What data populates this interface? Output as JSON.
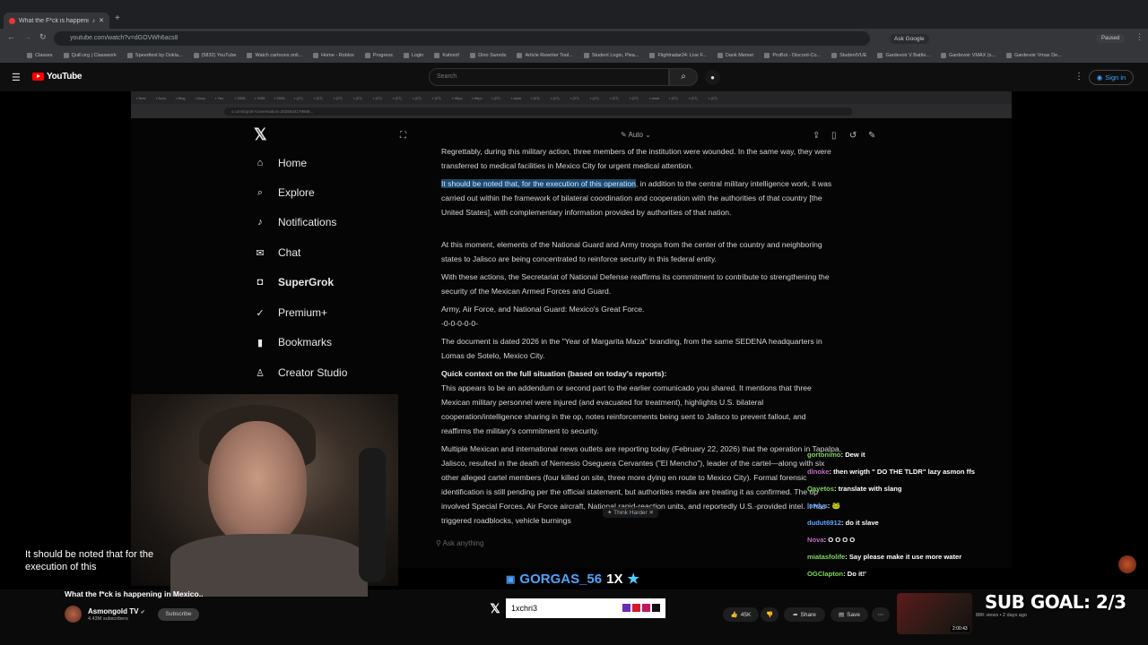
{
  "browser": {
    "tab_title": "What the F*ck is happening...",
    "url": "youtube.com/watch?v=dGOVWh6acs8",
    "ask_google": "Ask Google",
    "paused": "Paused",
    "bookmarks": [
      "Classes",
      "Quill.org | Classwork",
      "Speedtest by Ookla...",
      "(5832) YouTube",
      "Watch cartoons onli...",
      "Home - Roblox",
      "Progress",
      "Login",
      "Kahoot!",
      "Dino Swords",
      "Article Rewriter Tool...",
      "Student Login, Plea...",
      "Flightradar24: Live F...",
      "Dank Memer",
      "ProBot - Discord-Co...",
      "StudentVUE",
      "Gardevoir V Battle...",
      "Gardevoir VMAX (s...",
      "Gardevoir Vmax De..."
    ]
  },
  "youtube": {
    "logo_text": "YouTube",
    "search_placeholder": "Search",
    "sign_in": "Sign in",
    "video_title": "What the f*ck is happening in Mexico..",
    "channel_name": "Asmongold TV",
    "channel_subs": "4.43M subscribers",
    "subscribe_label": "Subscribe",
    "likes": "45K",
    "share": "Share",
    "save": "Save",
    "next_views": "88K views • 2 days ago",
    "next_duration": "2:00:43"
  },
  "xpage": {
    "nav": [
      {
        "label": "Home",
        "icon": "home-icon",
        "glyph": "⌂"
      },
      {
        "label": "Explore",
        "icon": "search-icon",
        "glyph": "⌕"
      },
      {
        "label": "Notifications",
        "icon": "bell-icon",
        "glyph": "♪"
      },
      {
        "label": "Chat",
        "icon": "mail-icon",
        "glyph": "✉"
      },
      {
        "label": "SuperGrok",
        "icon": "grok-icon",
        "glyph": "◘"
      },
      {
        "label": "Premium+",
        "icon": "premium-icon",
        "glyph": "✓"
      },
      {
        "label": "Bookmarks",
        "icon": "bookmark-icon",
        "glyph": "▮"
      },
      {
        "label": "Creator Studio",
        "icon": "creator-icon",
        "glyph": "♙"
      }
    ],
    "mode": "Auto",
    "paragraphs": {
      "p1": "Regrettably, during this military action, three members of the institution were wounded. In the same way, they were transferred to medical facilities in Mexico City for urgent medical attention.",
      "p2_highlight": "It should be noted that, for the execution of this operation",
      "p2_rest": ", in addition to the central military intelligence work, it was carried out within the framework of bilateral coordination and cooperation with the authorities of that country [the United States], with complementary information provided by authorities of that nation.",
      "p3": "At this moment, elements of the National Guard and Army troops from the center of the country and neighboring states to Jalisco are being concentrated to reinforce security in this federal entity.",
      "p4": "With these actions, the Secretariat of National Defense reaffirms its commitment to contribute to strengthening the security of the Mexican Armed Forces and Guard.",
      "p5a": "Army, Air Force, and National Guard: Mexico's Great Force.",
      "p5b": "-0-0-0-0-0-",
      "p6": "The document is dated 2026 in the \"Year of Margarita Maza\" branding, from the same SEDENA headquarters in Lomas de Sotelo, Mexico City.",
      "p7_heading": "Quick context on the full situation (based on today's reports):",
      "p7": "This appears to be an addendum or second part to the earlier comunicado you shared. It mentions that three Mexican military personnel were injured (and evacuated for treatment), highlights U.S. bilateral cooperation/intelligence sharing in the op, notes reinforcements being sent to Jalisco to prevent fallout, and reaffirms the military's commitment to security.",
      "p8": "Multiple Mexican and international news outlets are reporting today (February 22, 2026) that the operation in Tapalpa, Jalisco, resulted in the death of Nemesio Oseguera Cervantes (\"El Mencho\"), leader of the cartel—along with six other alleged cartel members (four killed on site, three more dying en route to Mexico City). Formal forensic identification is still pending per the official statement, but authorities media are treating it as confirmed. The op involved Special Forces, Air Force aircraft, National rapid-reaction units, and reportedly U.S.-provided intel. It has triggered roadblocks, vehicle burnings"
    },
    "think_harder": "Think Harder",
    "ask_placeholder": "Ask anything"
  },
  "chat": [
    {
      "user": "gortonimo",
      "msg": "Dew it"
    },
    {
      "user": "dlnoke",
      "msg": "then wrigth \" DO THE TLDR\" lazy asmon ffs"
    },
    {
      "user": "Qayetos",
      "msg": "translate with slang"
    },
    {
      "user": "lawlys",
      "msg": ""
    },
    {
      "user": "dudut6912",
      "msg": "do it slave"
    },
    {
      "user": "Nova",
      "msg": "O O O O"
    },
    {
      "user": "miatasfolife",
      "msg": "Say please make it use more water"
    },
    {
      "user": "OGClapton",
      "msg": "Do it!'"
    }
  ],
  "overlay": {
    "caption": "It should be noted that for the execution of this",
    "gorgas_name": "GORGAS_56",
    "gorgas_mult": "1X",
    "x_handle": "1xchri3",
    "sub_goal": "SUB GOAL: 2/3",
    "colors": {
      "accent": "#4ea3ff",
      "sq1": "#6a2bb5",
      "sq2": "#d11a2a",
      "sq3": "#c2185b",
      "sq4": "#111111"
    }
  }
}
